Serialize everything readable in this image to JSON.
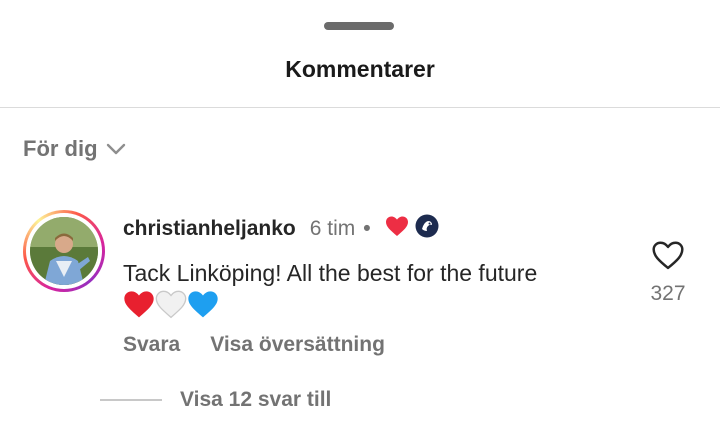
{
  "sheet": {
    "title": "Kommentarer"
  },
  "filter": {
    "label": "För dig"
  },
  "comment": {
    "username": "christianheljanko",
    "time": "6 tim",
    "separator": "•",
    "text": "Tack Linköping! All the best for the future",
    "emoji": [
      "red-heart",
      "white-heart",
      "blue-heart"
    ],
    "like_count": "327",
    "reply_label": "Svara",
    "translate_label": "Visa översättning",
    "view_replies_label": "Visa 12 svar till"
  },
  "colors": {
    "accent_red": "#ed2e44",
    "muted_text": "#737373",
    "primary_text": "#262626"
  }
}
